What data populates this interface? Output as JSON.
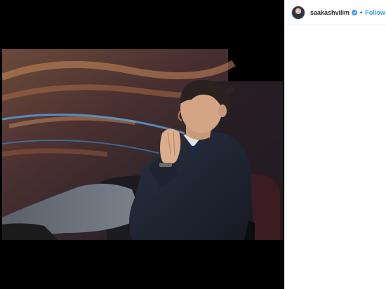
{
  "post": {
    "author": {
      "username": "saakashvilim",
      "verified": true,
      "avatar_icon": "profile-avatar"
    },
    "separator": "•",
    "follow_label": "Follow",
    "accent_color": "#3897f0"
  }
}
